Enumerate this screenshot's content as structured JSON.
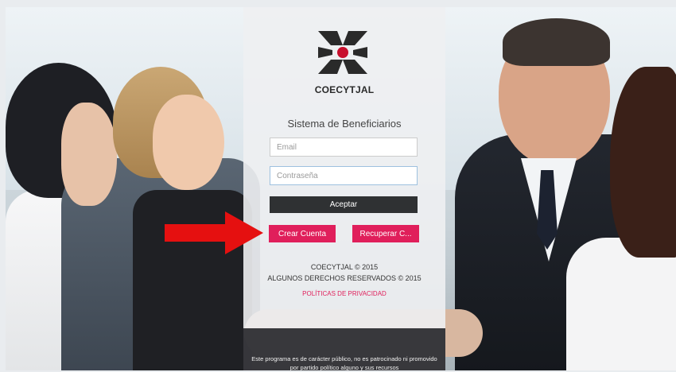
{
  "brand": {
    "name": "COECYTJAL",
    "colors": {
      "accent": "#e01f5b",
      "dark_button": "#2f3133",
      "logo_dark": "#2a2a2a",
      "logo_red": "#c8102e",
      "arrow": "#e51010"
    }
  },
  "login": {
    "title": "Sistema de Beneficiarios",
    "email_placeholder": "Email",
    "password_placeholder": "Contraseña",
    "accept_label": "Aceptar",
    "create_account_label": "Crear Cuenta",
    "recover_label": "Recuperar C..."
  },
  "footer": {
    "copyright_line1": "COECYTJAL © 2015",
    "copyright_line2": "ALGUNOS DERECHOS RESERVADOS © 2015",
    "privacy_link": "POLÍTICAS DE PRIVACIDAD",
    "notice": "Este programa es de carácter público, no es patrocinado ni promovido por partido político alguno y sus recursos"
  },
  "annotation": {
    "icon": "red-arrow-icon"
  }
}
